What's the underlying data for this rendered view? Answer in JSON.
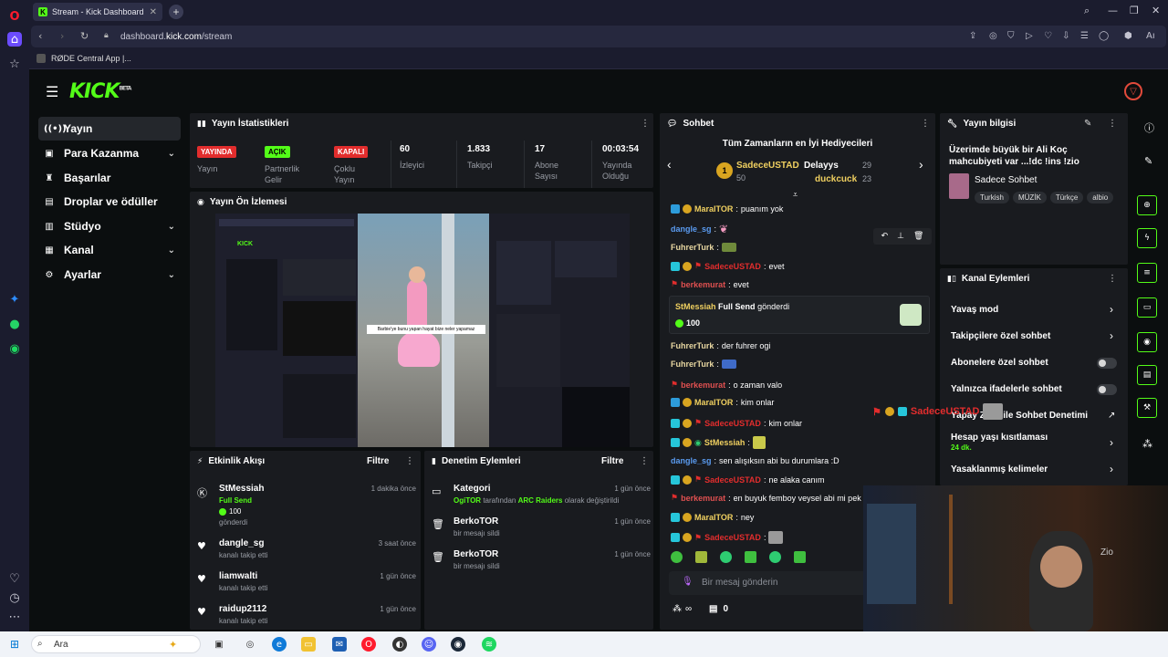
{
  "browser": {
    "tab_title": "Stream - Kick Dashboard",
    "url_prefix": "dashboard.",
    "url_domain": "kick.com",
    "url_path": "/stream",
    "bookmark": "RØDE Central App |..."
  },
  "brand": {
    "logo": "KICK",
    "beta": "BETA"
  },
  "sidebar": {
    "items": [
      {
        "label": "Yayın"
      },
      {
        "label": "Para Kazanma"
      },
      {
        "label": "Başarılar"
      },
      {
        "label": "Droplar ve ödüller"
      },
      {
        "label": "Stüdyo"
      },
      {
        "label": "Kanal"
      },
      {
        "label": "Ayarlar"
      }
    ]
  },
  "stats": {
    "title": "Yayın İstatistikleri",
    "badges": [
      {
        "badge": "YAYINDA",
        "label": "Yayın"
      },
      {
        "badge": "AÇIK",
        "label": "Partnerlik Gelir"
      },
      {
        "badge": "KAPALI",
        "label": "Çoklu Yayın"
      }
    ],
    "numbers": [
      {
        "value": "60",
        "label": "İzleyici"
      },
      {
        "value": "1.833",
        "label": "Takipçi"
      },
      {
        "value": "17",
        "label": "Abone Sayısı"
      },
      {
        "value": "00:03:54",
        "label": "Yayında Olduğu"
      }
    ]
  },
  "preview": {
    "title": "Yayın Ön İzlemesi",
    "caption": "Barbie'ye bunu yapan hayat bize neler yapamaz"
  },
  "activity": {
    "title": "Etkinlik Akışı",
    "filter": "Filtre",
    "items": [
      {
        "name": "StMessiah",
        "sub": "Full Send",
        "amount": "100",
        "extra": "gönderdi",
        "time": "1 dakika önce"
      },
      {
        "name": "dangle_sg",
        "sub": "kanalı takip etti",
        "time": "3 saat önce"
      },
      {
        "name": "liamwalti",
        "sub": "kanalı takip etti",
        "time": "1 gün önce"
      },
      {
        "name": "raidup2112",
        "sub": "kanalı takip etti",
        "time": "1 gün önce"
      }
    ]
  },
  "moderation": {
    "title": "Denetim Eylemleri",
    "filter": "Filtre",
    "items": [
      {
        "name": "Kategori",
        "sub_user": "OgiTOR",
        "sub_mid": "tarafından",
        "sub_cat": "ARC Raiders",
        "sub_end": "olarak değiştirildi",
        "time": "1 gün önce"
      },
      {
        "name": "BerkoTOR",
        "sub": "bir mesajı sildi",
        "time": "1 gün önce"
      },
      {
        "name": "BerkoTOR",
        "sub": "bir mesajı sildi",
        "time": "1 gün önce"
      }
    ]
  },
  "chat": {
    "title": "Sohbet",
    "gifters_title": "Tüm Zamanların en İyi Hediyecileri",
    "gifters": [
      {
        "name": "SadeceUSTAD",
        "count": "50"
      },
      {
        "name": "Delayys",
        "count": "29"
      },
      {
        "name": "duckcuck",
        "count": "23"
      }
    ],
    "messages": [
      {
        "user": "MaraITOR",
        "text": "puanım yok"
      },
      {
        "user": "dangle_sg",
        "text": ""
      },
      {
        "user": "FuhrerTurk",
        "text": ""
      },
      {
        "user": "SadeceUSTAD",
        "text": "evet"
      },
      {
        "user": "berkemurat",
        "text": "evet"
      },
      {
        "user": "FuhrerTurk",
        "text": "der fuhrer ogi"
      },
      {
        "user": "FuhrerTurk",
        "text": ""
      },
      {
        "user": "berkemurat",
        "text": "o zaman valo"
      },
      {
        "user": "MaraITOR",
        "text": "kim onlar"
      },
      {
        "user": "SadeceUSTAD",
        "text": "kim onlar"
      },
      {
        "user": "StMessiah",
        "text": ""
      },
      {
        "user": "dangle_sg",
        "text": "sen alışıksın abi bu durumlara :D"
      },
      {
        "user": "SadeceUSTAD",
        "text": "ne alaka canım"
      },
      {
        "user": "berkemurat",
        "text": "en buyuk femboy veysel abi mi pek"
      },
      {
        "user": "MaraITOR",
        "text": "ney"
      },
      {
        "user": "SadeceUSTAD",
        "text": ""
      }
    ],
    "gift_card": {
      "user": "StMessiah",
      "item": "Full Send",
      "verb": "gönderdi",
      "amount": "100"
    },
    "input_placeholder": "Bir mesaj gönderin",
    "points": "∞",
    "gift_count": "0"
  },
  "stream_info": {
    "title": "Yayın bilgisi",
    "stream_title": "Üzerimde büyük bir Ali Koç mahcubiyeti var ...!dc !ins !zio",
    "category": "Sadece Sohbet",
    "tags": [
      "Turkish",
      "MÜZİK",
      "Türkçe",
      "albio"
    ]
  },
  "channel_actions": {
    "title": "Kanal Eylemleri",
    "items": [
      {
        "label": "Yavaş mod"
      },
      {
        "label": "Takipçilere özel sohbet"
      },
      {
        "label": "Abonelere özel sohbet"
      },
      {
        "label": "Yalnızca ifadelerle sohbet"
      },
      {
        "label": "Yapay Zeka ile Sohbet Denetimi"
      },
      {
        "label": "Hesap yaşı kısıtlaması",
        "sub": "24 dk."
      },
      {
        "label": "Yasaklanmış kelimeler"
      }
    ]
  },
  "overlay": {
    "user": "SadeceUSTAD",
    "watermark": "Zio"
  },
  "taskbar": {
    "search": "Ara"
  },
  "colors": {
    "kick_green": "#53fc18",
    "panel": "#191b1f",
    "bg": "#0b0e0f",
    "live_red": "#e22d2d"
  }
}
